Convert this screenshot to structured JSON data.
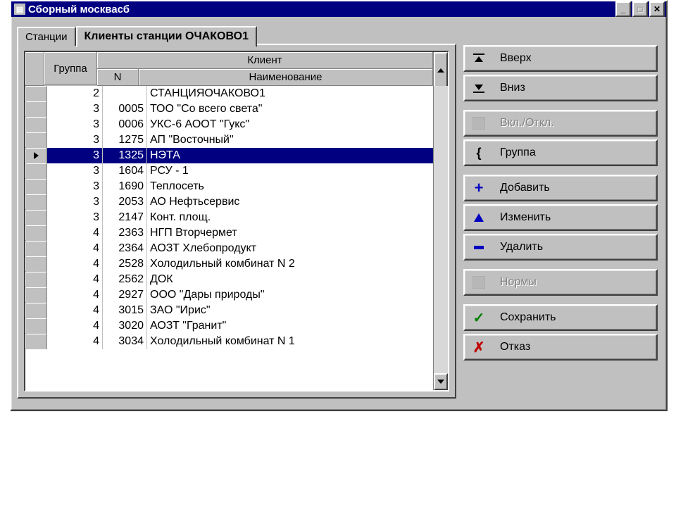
{
  "window": {
    "title": "Сборный москвасб"
  },
  "tabs": {
    "inactive": "Станции",
    "active": "Клиенты станции ОЧАКОВО1"
  },
  "grid": {
    "headers": {
      "group": "Группа",
      "client": "Клиент",
      "n": "N",
      "name": "Наименование"
    },
    "rows": [
      {
        "group": "2",
        "n": "",
        "name": "СТАНЦИЯОЧАКОВО1"
      },
      {
        "group": "3",
        "n": "0005",
        "name": "ТОО \"Со всего света\""
      },
      {
        "group": "3",
        "n": "0006",
        "name": "УКС-6 АООТ \"Гукс\""
      },
      {
        "group": "3",
        "n": "1275",
        "name": "АП \"Восточный\""
      },
      {
        "group": "3",
        "n": "1325",
        "name": "НЭТА",
        "selected": true
      },
      {
        "group": "3",
        "n": "1604",
        "name": "РСУ - 1"
      },
      {
        "group": "3",
        "n": "1690",
        "name": "Теплосеть"
      },
      {
        "group": "3",
        "n": "2053",
        "name": "АО Нефтьсервис"
      },
      {
        "group": "3",
        "n": "2147",
        "name": "Конт. площ."
      },
      {
        "group": "4",
        "n": "2363",
        "name": "НГП Вторчермет"
      },
      {
        "group": "4",
        "n": "2364",
        "name": "АОЗТ Хлебопродукт"
      },
      {
        "group": "4",
        "n": "2528",
        "name": "Холодильный комбинат N 2"
      },
      {
        "group": "4",
        "n": "2562",
        "name": "ДОК"
      },
      {
        "group": "4",
        "n": "2927",
        "name": "ООО \"Дары природы\""
      },
      {
        "group": "4",
        "n": "3015",
        "name": "ЗАО \"Ирис\""
      },
      {
        "group": "4",
        "n": "3020",
        "name": "АОЗТ \"Гранит\""
      },
      {
        "group": "4",
        "n": "3034",
        "name": "Холодильный комбинат N 1"
      }
    ]
  },
  "buttons": {
    "up": "Вверх",
    "down": "Вниз",
    "off": "Вкл./Откл.",
    "group": "Группа",
    "add": "Добавить",
    "edit": "Изменить",
    "del": "Удалить",
    "norms": "Нормы",
    "save": "Сохранить",
    "cancel": "Отказ"
  }
}
